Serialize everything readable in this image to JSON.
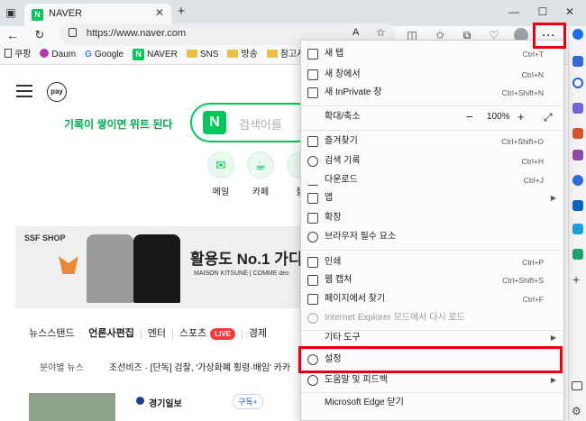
{
  "tab": {
    "title": "NAVER"
  },
  "address": {
    "url": "https://www.naver.com",
    "read_aloud": "A"
  },
  "bookmarks": [
    {
      "label": "쿠팡",
      "icon": "bookmark-icon"
    },
    {
      "label": "Daum",
      "icon": "daum-icon"
    },
    {
      "label": "Google",
      "icon": "google-icon"
    },
    {
      "label": "NAVER",
      "icon": "naver-icon"
    },
    {
      "label": "SNS",
      "icon": "folder-icon"
    },
    {
      "label": "방송",
      "icon": "folder-icon"
    },
    {
      "label": "참고사이",
      "icon": "folder-icon"
    }
  ],
  "page": {
    "pay": "pay",
    "slogan": "기록이 쌓이면 위트 된다",
    "search_placeholder": "검색어를",
    "logo": "N",
    "shortcuts": [
      {
        "label": "메일"
      },
      {
        "label": "카페"
      },
      {
        "label": "블"
      }
    ],
    "banner": {
      "brand": "SSF SHOP",
      "headline": "활용도 No.1 가디",
      "sub": "MAISON KITSUNÉ | COMME des"
    },
    "news_tabs": [
      "뉴스스탠드",
      "언론사편집",
      "엔터",
      "스포츠",
      "경제"
    ],
    "live_badge": "LIVE",
    "news_category": "분야별 뉴스",
    "news_ticker": "조선비즈 · [단독] 검찰, '가상화폐 횡령·배임' 카카",
    "press_name": "경기일보",
    "subscribe": "구독+"
  },
  "menu": {
    "new_tab": {
      "label": "새 탭",
      "shortcut": "Ctrl+T"
    },
    "new_window": {
      "label": "새 창에서",
      "shortcut": "Ctrl+N"
    },
    "inprivate": {
      "label": "새 InPrivate 창",
      "shortcut": "Ctrl+Shift+N"
    },
    "zoom": {
      "label": "확대/축소",
      "minus": "−",
      "value": "100%",
      "plus": "+"
    },
    "favorites": {
      "label": "즐겨찾기",
      "shortcut": "Ctrl+Shift+O"
    },
    "history": {
      "label": "검색 기록",
      "shortcut": "Ctrl+H"
    },
    "downloads": {
      "label": "다운로드",
      "shortcut": "Ctrl+J"
    },
    "apps": {
      "label": "앱"
    },
    "extensions": {
      "label": "확장"
    },
    "essentials": {
      "label": "브라우저 필수 요소"
    },
    "print": {
      "label": "인쇄",
      "shortcut": "Ctrl+P"
    },
    "capture": {
      "label": "웹 캡처",
      "shortcut": "Ctrl+Shift+S"
    },
    "find": {
      "label": "페이지에서 찾기",
      "shortcut": "Ctrl+F"
    },
    "ie_mode": {
      "label": "Internet Explorer 모드에서 다시 로드"
    },
    "more_tools": {
      "label": "기타 도구"
    },
    "settings": {
      "label": "설정"
    },
    "help": {
      "label": "도움말 및 피드백"
    },
    "close": {
      "label": "Microsoft Edge 닫기"
    }
  },
  "colors": {
    "highlight": "#e50012",
    "naver_green": "#03c75a"
  }
}
